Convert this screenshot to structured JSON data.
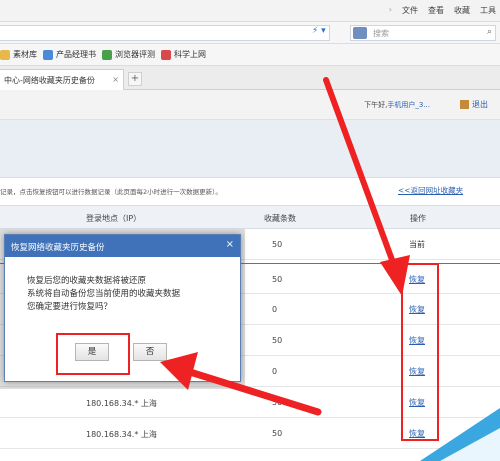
{
  "browser": {
    "menus": [
      "文件",
      "查看",
      "收藏",
      "工具"
    ],
    "search_placeholder": "搜索",
    "favorites": [
      "素材库",
      "产品经理书",
      "浏览器评测",
      "科学上网"
    ],
    "tab_title": "中心-网络收藏夹历史备份",
    "tab_close": "×",
    "new_tab": "+"
  },
  "header": {
    "user_label": "下午好,",
    "user_name": "手机用户_3...",
    "logout": "退出"
  },
  "notice": "记录，点击恢复按钮可以进行数据记录（此页面每2小时进行一次数据更新）。",
  "back_link": "<<返回网址收藏夹",
  "table": {
    "col_ip": "登录地点（IP）",
    "col_count": "收藏条数",
    "col_op": "操作",
    "rows": [
      {
        "ip": "",
        "count": "50",
        "op": "当前",
        "current": true
      },
      {
        "ip": "",
        "count": "50",
        "op": "恢复",
        "current": false
      },
      {
        "ip": "",
        "count": "0",
        "op": "恢复",
        "current": false
      },
      {
        "ip": "",
        "count": "50",
        "op": "恢复",
        "current": false
      },
      {
        "ip": "",
        "count": "0",
        "op": "恢复",
        "current": false
      },
      {
        "ip": "180.168.34.* 上海",
        "count": "50",
        "op": "恢复",
        "current": false
      },
      {
        "ip": "180.168.34.* 上海",
        "count": "50",
        "op": "恢复",
        "current": false
      }
    ]
  },
  "dialog": {
    "title": "恢复网络收藏夹历史备份",
    "close": "×",
    "line1": "恢复后您的收藏夹数据将被还原",
    "line2": "系统将自动备份您当前使用的收藏夹数据",
    "line3": "您确定要进行恢复吗？",
    "yes": "是",
    "no": "否"
  },
  "colors": {
    "annotation": "#ee2222",
    "dialog_title_bg": "#3f72b8",
    "link": "#2a5fb0"
  }
}
